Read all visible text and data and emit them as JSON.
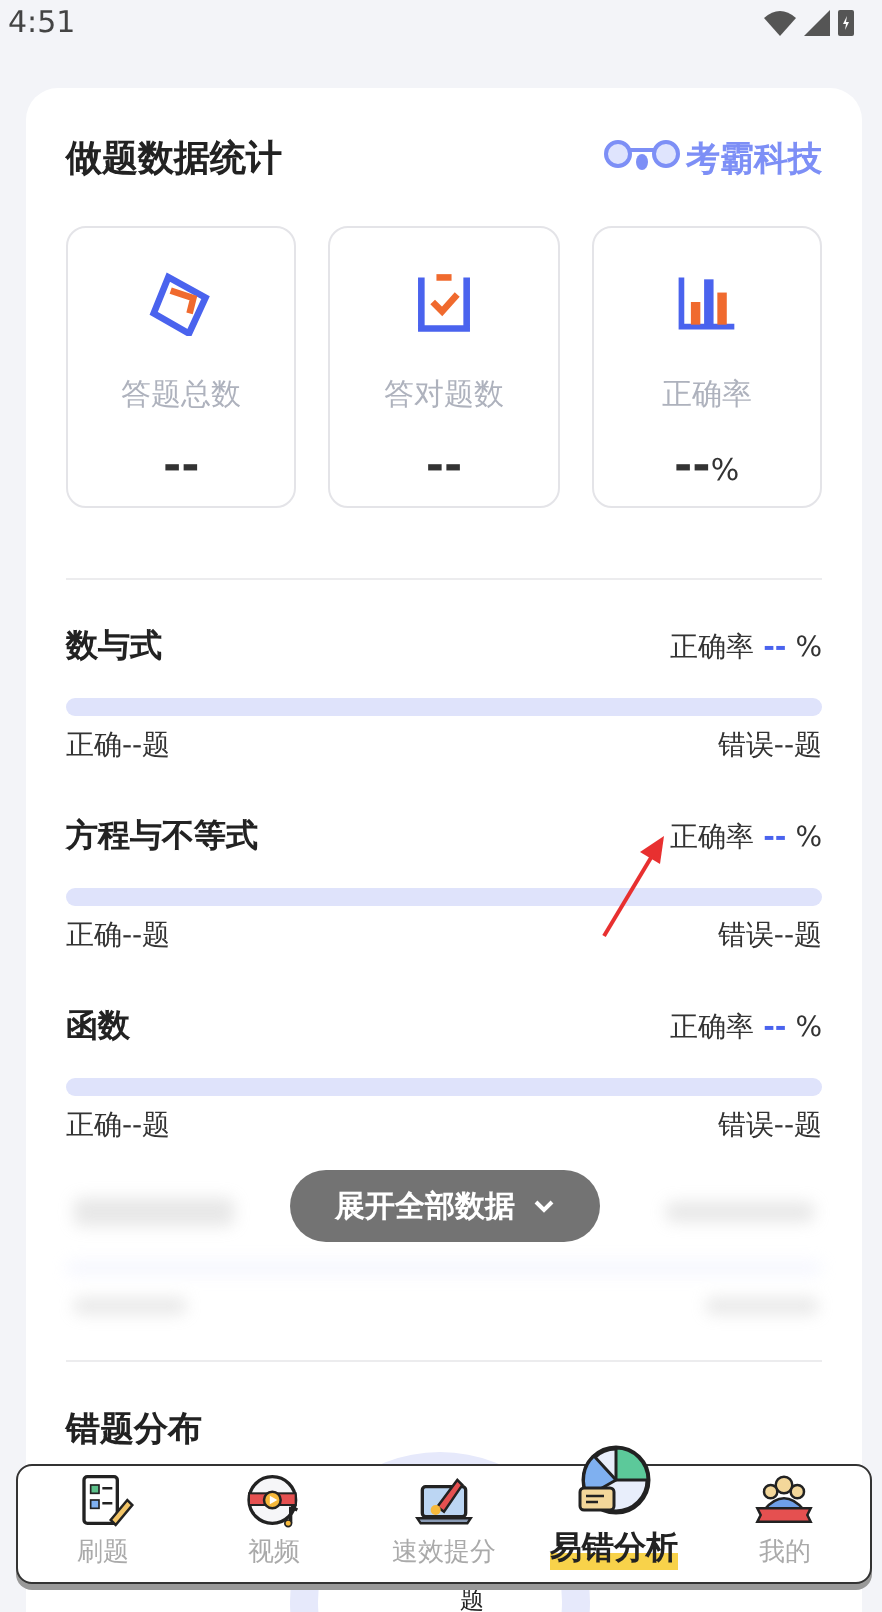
{
  "status_bar": {
    "time": "4:51"
  },
  "card": {
    "title": "做题数据统计",
    "brand": "考霸科技"
  },
  "stats": [
    {
      "kind": "total",
      "label": "答题总数",
      "value": "--"
    },
    {
      "kind": "correct",
      "label": "答对题数",
      "value": "--"
    },
    {
      "kind": "rate",
      "label": "正确率",
      "value": "--",
      "unit": "%"
    }
  ],
  "categories": [
    {
      "name": "数与式",
      "rate_label": "正确率",
      "rate_value": "--",
      "rate_unit": "%",
      "correct": "正确--题",
      "wrong": "错误--题"
    },
    {
      "name": "方程与不等式",
      "rate_label": "正确率",
      "rate_value": "--",
      "rate_unit": "%",
      "correct": "正确--题",
      "wrong": "错误--题"
    },
    {
      "name": "函数",
      "rate_label": "正确率",
      "rate_value": "--",
      "rate_unit": "%",
      "correct": "正确--题",
      "wrong": "错误--题"
    }
  ],
  "expand_button": "展开全部数据",
  "section_title": "错题分布",
  "chart_caption": "题",
  "nav": [
    {
      "kind": "practice",
      "label": "刷题",
      "selected": false
    },
    {
      "kind": "video",
      "label": "视频",
      "selected": false
    },
    {
      "kind": "boost",
      "label": "速效提分",
      "selected": false
    },
    {
      "kind": "analysis",
      "label": "易错分析",
      "selected": true
    },
    {
      "kind": "profile",
      "label": "我的",
      "selected": false
    }
  ]
}
